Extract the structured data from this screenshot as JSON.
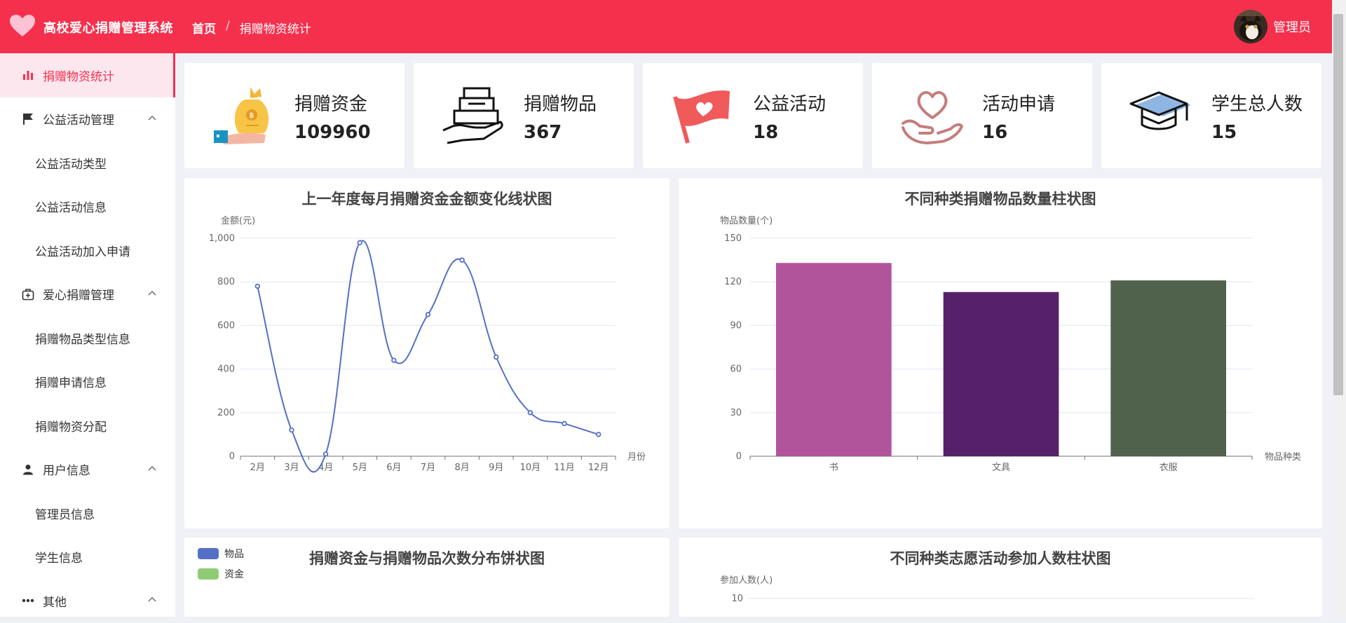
{
  "header": {
    "app_title": "高校爱心捐赠管理系统",
    "breadcrumb_home": "首页",
    "breadcrumb_sep": "/",
    "breadcrumb_current": "捐赠物资统计",
    "user_name": "管理员",
    "brand_color": "#f5304d"
  },
  "sidebar": {
    "items": [
      {
        "label": "捐赠物资统计",
        "level": "top",
        "icon": "bar-chart-icon",
        "active": true
      },
      {
        "label": "公益活动管理",
        "level": "top",
        "icon": "flag-icon",
        "expanded": true
      },
      {
        "label": "公益活动类型",
        "level": "sub"
      },
      {
        "label": "公益活动信息",
        "level": "sub"
      },
      {
        "label": "公益活动加入申请",
        "level": "sub"
      },
      {
        "label": "爱心捐赠管理",
        "level": "top",
        "icon": "medical-box-icon",
        "expanded": true
      },
      {
        "label": "捐赠物品类型信息",
        "level": "sub"
      },
      {
        "label": "捐赠申请信息",
        "level": "sub"
      },
      {
        "label": "捐赠物资分配",
        "level": "sub"
      },
      {
        "label": "用户信息",
        "level": "top",
        "icon": "user-icon",
        "expanded": true
      },
      {
        "label": "管理员信息",
        "level": "sub"
      },
      {
        "label": "学生信息",
        "level": "sub"
      },
      {
        "label": "其他",
        "level": "top",
        "icon": "more-icon",
        "expanded": true
      }
    ]
  },
  "stats": [
    {
      "label": "捐赠资金",
      "value": "109960",
      "icon": "money-bag-icon"
    },
    {
      "label": "捐赠物品",
      "value": "367",
      "icon": "donation-box-icon"
    },
    {
      "label": "公益活动",
      "value": "18",
      "icon": "flag-heart-icon"
    },
    {
      "label": "活动申请",
      "value": "16",
      "icon": "heart-hand-icon"
    },
    {
      "label": "学生总人数",
      "value": "15",
      "icon": "graduation-cap-icon"
    }
  ],
  "chart_data": [
    {
      "type": "line",
      "title": "上一年度每月捐赠资金金额变化线状图",
      "ylabel": "金额(元)",
      "xlabel": "月份",
      "categories": [
        "2月",
        "3月",
        "4月",
        "5月",
        "6月",
        "7月",
        "8月",
        "9月",
        "10月",
        "11月",
        "12月"
      ],
      "values": [
        780,
        120,
        10,
        980,
        440,
        650,
        900,
        455,
        200,
        150,
        100
      ],
      "ylim": [
        0,
        1000
      ],
      "yticks": [
        "0",
        "200",
        "400",
        "600",
        "800",
        "1,000"
      ],
      "smooth": true,
      "color": "#5470c6",
      "grid": true
    },
    {
      "type": "bar",
      "title": "不同种类捐赠物品数量柱状图",
      "ylabel": "物品数量(个)",
      "xlabel": "物品种类",
      "categories": [
        "书",
        "文具",
        "衣服"
      ],
      "values": [
        133,
        113,
        121
      ],
      "colors": [
        "#b0549c",
        "#56206a",
        "#50614c"
      ],
      "ylim": [
        0,
        150
      ],
      "yticks": [
        "0",
        "30",
        "60",
        "90",
        "120",
        "150"
      ],
      "grid": true
    },
    {
      "type": "pie",
      "title": "捐赠资金与捐赠物品次数分布饼状图",
      "legend": [
        {
          "name": "物品",
          "color": "#5470c6"
        },
        {
          "name": "资金",
          "color": "#91cc75"
        }
      ],
      "legend_position": "top-left"
    },
    {
      "type": "bar",
      "title": "不同种类志愿活动参加人数柱状图",
      "ylabel": "参加人数(人)",
      "yticks": [
        "10"
      ]
    }
  ]
}
